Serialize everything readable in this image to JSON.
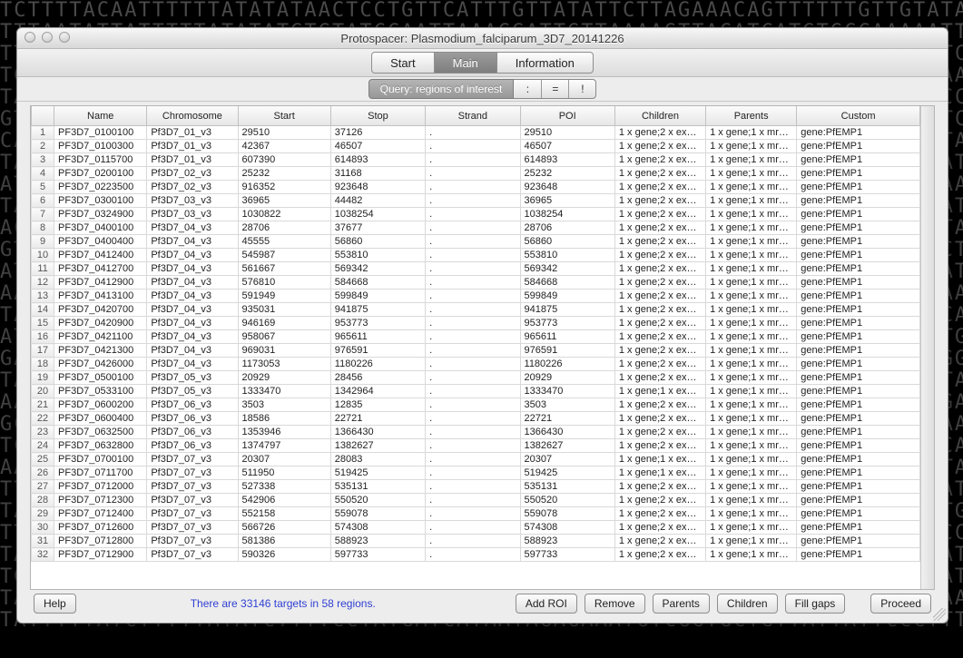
{
  "dna_backdrop": "TCTTTTACAATTTTTTATATATAACTCCTGTTCATTTGTTATATTCTTAGAAACAGTTTTTTGTTGTATAATTTATA\nTTTAATATTATTTTTATATATGTGTATCCAATTAAAGGATTGTTAAAAGTTACATCATGTGCCAAAAATTTTCTTAT\nTTACCATTTTTTATGTTGTTAAAATTTTTTGCGTTTTTTTACTTTTTGTCTGTATGGTTTTCTGTTGATCATTTTCT\nTGCATTTTTTTCCTCTCGGGTCGCCTCCAAAAAAGATTCTATAATAAAGAATGCTTGTTTCTCTTTGAAAATTGCGG\nTAGCAGTAAATACACATATTTTGTGGTAGAGTATACGAATAAAACAGAATAGGTCATAATATTCAGCACCGATAGAA\nGTCAAATCCTTCACGTCCTTTAAAATCGTTAGTTTTGACAATGTTGATGATGTTTTAATACTTCTTCTTCGCATTTT\nCATTTAAATTTGTTGTTTGTTTTATTGTTTGTTAAATCTTTTTTTAGTAAAAATTTTTTATAATAAAATATAATTCT\nTAAGAAACTCTTTTTTCCAAGACATTTCTCTTATTTAAAAAACATGAAATGTCATATAACGTTTTTAAATGCCCAGA\nATTTAATTTTATAATAAAATATAATTCTTAAGAAACTCTTTTTTCCAAGACATTTCTCTTATTTAAAAAACATGAAA\nTAAAGGATTGTTAAAAGTTACATCATGTGCCAAAAATTTTCTTATTTACCATTTTTTATGTTGTTAAAATTTTTTGC\nACAAAAATTTTCTTATTTACCATTTTTTATGTTGTTAAAATTTTTTGCGTTTTTTTACTTTTTGTCTGTATGGTTTT\nGTGCATATACCAAATTTAATTTTTCTCTATCATTTAATTTTATAATAAAATATAATTCTTAAGAAACTCTTTTTTCC\nATTATAAATAACAAGAATAAGATATCAGTACATAAAAATGTACATATTAAAAATTAAAAAAATTTATGATTCTATAT\nAATTAAAGGATTGTTAAAAGTTACATCATGTGCCAAAAATTTTCTTATTTACCATTTTTTATGTTGTTAAAATTTTT\nTAGCAATTACATGAAATTAAGTATAATAACATGGTAAAATATATAAAAAACAGCAATCCATTCATCAACAAAAAAAA\nATTCAGCACCGATAGAATGTCAAATCCTTCACGTCCTTTAAAATCGTTAGTTTTGACAATGTTGATGATGTTTTAAT\nGATGAAAGGCATTACCTTCCCAGCTCTTTCTTTTTTCAGCAATTACATGAAATTAAGTATAATAACATGGTAAAATA\nTATGCATCGAAATAATTTTATAATAAAATATAATTCTTAAGAAACTCTTTTTTCCAAGACATTTCTCTTATTTAAAA\nAAGTATAATAACATGGTAAAATATATAAAAAACAGCAATCCATTCATCAACAAAAAAAATTCAGCACCGATAGAATG\nGCGATAAATTTTGTTTATTTATTATTTTTCAAAGAGCGTCAATTAAATATTTTTTTTTTTTTTTTGGTAACCAAACC\nTCTATTTGTTTGTAATAGAGAATAACCAATACTTTGTGGCCCTAGCATCAACCCAAAATCAACCACATCAGGTACAG\nAATAAGAATGCATACAGCATATGCGTAATATTTTATTTTATTCCATTTTTATATTATTATTTCAATATTAATTAAAA\nTTTTGAATTTATTTTATATTTTAAAATAAATTACCATCCTATAAATAACAAGAATAAGATATCAGTACATAAAAATG\nTATTTTATAATAAAATATAATTCTTAAGAAACTCTTTTTTCCAAGACATTTCTCTTATTTAAAAAACATGAAATGTC\nTTCATTCATTATTACCGAGATAAAAAGTTTTATTATGCAAGCCATATCGATGTTTTTAATGATTCCACCCCCTGAAA\nTACCTCACCCATAATATATTCCAAATTTATGAAGGTCCAATCCATCAATGGTTTTTGCTACATAGGTAATTTTAGTT\nTGGGTCAATTTAATTAAATTCACCATTAGTAATAAAAAATTATCTCCAACATCATCTTTTCCTATGAGATATTGAGA\nTATTTATAATTTATTTGTTTTTTTTTTCTTTTTTTTCTTTTTTTAAGTTTGACCATAATCAAAATAAAAAATCACCT\nTATTTTTATCTTTTTATATCTTTTCCTATGATCATAATAGAGAAATGTCGGTGCTGTTATTATTCCCTTTGTTTCAA",
  "window": {
    "title": "Protospacer: Plasmodium_falciparum_3D7_20141226",
    "tabs": {
      "start": "Start",
      "main": "Main",
      "info": "Information"
    },
    "query_label": "Query: regions of interest",
    "query_ops": {
      "colon": ":",
      "eq": "=",
      "bang": "!"
    }
  },
  "columns": [
    "",
    "Name",
    "Chromosome",
    "Start",
    "Stop",
    "Strand",
    "POI",
    "Children",
    "Parents",
    "Custom"
  ],
  "status_line": "There are 33146 targets in 58 regions.",
  "buttons": {
    "help": "Help",
    "add_roi": "Add ROI",
    "remove": "Remove",
    "parents": "Parents",
    "children": "Children",
    "fill_gaps": "Fill gaps",
    "proceed": "Proceed"
  },
  "rows": [
    {
      "n": "1",
      "name": "PF3D7_0100100",
      "chr": "Pf3D7_01_v3",
      "start": "29510",
      "stop": "37126",
      "strand": ".",
      "poi": "29510",
      "children": "1 x gene;2 x ex…",
      "parents": "1 x gene;1 x mr…",
      "custom": "gene:PfEMP1"
    },
    {
      "n": "2",
      "name": "PF3D7_0100300",
      "chr": "Pf3D7_01_v3",
      "start": "42367",
      "stop": "46507",
      "strand": ".",
      "poi": "46507",
      "children": "1 x gene;2 x ex…",
      "parents": "1 x gene;1 x mr…",
      "custom": "gene:PfEMP1"
    },
    {
      "n": "3",
      "name": "PF3D7_0115700",
      "chr": "Pf3D7_01_v3",
      "start": "607390",
      "stop": "614893",
      "strand": ".",
      "poi": "614893",
      "children": "1 x gene;2 x ex…",
      "parents": "1 x gene;1 x mr…",
      "custom": "gene:PfEMP1"
    },
    {
      "n": "4",
      "name": "PF3D7_0200100",
      "chr": "Pf3D7_02_v3",
      "start": "25232",
      "stop": "31168",
      "strand": ".",
      "poi": "25232",
      "children": "1 x gene;2 x ex…",
      "parents": "1 x gene;1 x mr…",
      "custom": "gene:PfEMP1"
    },
    {
      "n": "5",
      "name": "PF3D7_0223500",
      "chr": "Pf3D7_02_v3",
      "start": "916352",
      "stop": "923648",
      "strand": ".",
      "poi": "923648",
      "children": "1 x gene;2 x ex…",
      "parents": "1 x gene;1 x mr…",
      "custom": "gene:PfEMP1"
    },
    {
      "n": "6",
      "name": "PF3D7_0300100",
      "chr": "Pf3D7_03_v3",
      "start": "36965",
      "stop": "44482",
      "strand": ".",
      "poi": "36965",
      "children": "1 x gene;2 x ex…",
      "parents": "1 x gene;1 x mr…",
      "custom": "gene:PfEMP1"
    },
    {
      "n": "7",
      "name": "PF3D7_0324900",
      "chr": "Pf3D7_03_v3",
      "start": "1030822",
      "stop": "1038254",
      "strand": ".",
      "poi": "1038254",
      "children": "1 x gene;2 x ex…",
      "parents": "1 x gene;1 x mr…",
      "custom": "gene:PfEMP1"
    },
    {
      "n": "8",
      "name": "PF3D7_0400100",
      "chr": "Pf3D7_04_v3",
      "start": "28706",
      "stop": "37677",
      "strand": ".",
      "poi": "28706",
      "children": "1 x gene;2 x ex…",
      "parents": "1 x gene;1 x mr…",
      "custom": "gene:PfEMP1"
    },
    {
      "n": "9",
      "name": "PF3D7_0400400",
      "chr": "Pf3D7_04_v3",
      "start": "45555",
      "stop": "56860",
      "strand": ".",
      "poi": "56860",
      "children": "1 x gene;2 x ex…",
      "parents": "1 x gene;1 x mr…",
      "custom": "gene:PfEMP1"
    },
    {
      "n": "10",
      "name": "PF3D7_0412400",
      "chr": "Pf3D7_04_v3",
      "start": "545987",
      "stop": "553810",
      "strand": ".",
      "poi": "553810",
      "children": "1 x gene;2 x ex…",
      "parents": "1 x gene;1 x mr…",
      "custom": "gene:PfEMP1"
    },
    {
      "n": "11",
      "name": "PF3D7_0412700",
      "chr": "Pf3D7_04_v3",
      "start": "561667",
      "stop": "569342",
      "strand": ".",
      "poi": "569342",
      "children": "1 x gene;2 x ex…",
      "parents": "1 x gene;1 x mr…",
      "custom": "gene:PfEMP1"
    },
    {
      "n": "12",
      "name": "PF3D7_0412900",
      "chr": "Pf3D7_04_v3",
      "start": "576810",
      "stop": "584668",
      "strand": ".",
      "poi": "584668",
      "children": "1 x gene;2 x ex…",
      "parents": "1 x gene;1 x mr…",
      "custom": "gene:PfEMP1"
    },
    {
      "n": "13",
      "name": "PF3D7_0413100",
      "chr": "Pf3D7_04_v3",
      "start": "591949",
      "stop": "599849",
      "strand": ".",
      "poi": "599849",
      "children": "1 x gene;2 x ex…",
      "parents": "1 x gene;1 x mr…",
      "custom": "gene:PfEMP1"
    },
    {
      "n": "14",
      "name": "PF3D7_0420700",
      "chr": "Pf3D7_04_v3",
      "start": "935031",
      "stop": "941875",
      "strand": ".",
      "poi": "941875",
      "children": "1 x gene;2 x ex…",
      "parents": "1 x gene;1 x mr…",
      "custom": "gene:PfEMP1"
    },
    {
      "n": "15",
      "name": "PF3D7_0420900",
      "chr": "Pf3D7_04_v3",
      "start": "946169",
      "stop": "953773",
      "strand": ".",
      "poi": "953773",
      "children": "1 x gene;2 x ex…",
      "parents": "1 x gene;1 x mr…",
      "custom": "gene:PfEMP1"
    },
    {
      "n": "16",
      "name": "PF3D7_0421100",
      "chr": "Pf3D7_04_v3",
      "start": "958067",
      "stop": "965611",
      "strand": ".",
      "poi": "965611",
      "children": "1 x gene;2 x ex…",
      "parents": "1 x gene;1 x mr…",
      "custom": "gene:PfEMP1"
    },
    {
      "n": "17",
      "name": "PF3D7_0421300",
      "chr": "Pf3D7_04_v3",
      "start": "969031",
      "stop": "976591",
      "strand": ".",
      "poi": "976591",
      "children": "1 x gene;2 x ex…",
      "parents": "1 x gene;1 x mr…",
      "custom": "gene:PfEMP1"
    },
    {
      "n": "18",
      "name": "PF3D7_0426000",
      "chr": "Pf3D7_04_v3",
      "start": "1173053",
      "stop": "1180226",
      "strand": ".",
      "poi": "1180226",
      "children": "1 x gene;2 x ex…",
      "parents": "1 x gene;1 x mr…",
      "custom": "gene:PfEMP1"
    },
    {
      "n": "19",
      "name": "PF3D7_0500100",
      "chr": "Pf3D7_05_v3",
      "start": "20929",
      "stop": "28456",
      "strand": ".",
      "poi": "20929",
      "children": "1 x gene;2 x ex…",
      "parents": "1 x gene;1 x mr…",
      "custom": "gene:PfEMP1"
    },
    {
      "n": "20",
      "name": "PF3D7_0533100",
      "chr": "Pf3D7_05_v3",
      "start": "1333470",
      "stop": "1342964",
      "strand": ".",
      "poi": "1333470",
      "children": "1 x gene;1 x ex…",
      "parents": "1 x gene;1 x mr…",
      "custom": "gene:PfEMP1"
    },
    {
      "n": "21",
      "name": "PF3D7_0600200",
      "chr": "Pf3D7_06_v3",
      "start": "3503",
      "stop": "12835",
      "strand": ".",
      "poi": "3503",
      "children": "1 x gene;2 x ex…",
      "parents": "1 x gene;1 x mr…",
      "custom": "gene:PfEMP1"
    },
    {
      "n": "22",
      "name": "PF3D7_0600400",
      "chr": "Pf3D7_06_v3",
      "start": "18586",
      "stop": "22721",
      "strand": ".",
      "poi": "22721",
      "children": "1 x gene;2 x ex…",
      "parents": "1 x gene;1 x mr…",
      "custom": "gene:PfEMP1"
    },
    {
      "n": "23",
      "name": "PF3D7_0632500",
      "chr": "Pf3D7_06_v3",
      "start": "1353946",
      "stop": "1366430",
      "strand": ".",
      "poi": "1366430",
      "children": "1 x gene;2 x ex…",
      "parents": "1 x gene;1 x mr…",
      "custom": "gene:PfEMP1"
    },
    {
      "n": "24",
      "name": "PF3D7_0632800",
      "chr": "Pf3D7_06_v3",
      "start": "1374797",
      "stop": "1382627",
      "strand": ".",
      "poi": "1382627",
      "children": "1 x gene;2 x ex…",
      "parents": "1 x gene;1 x mr…",
      "custom": "gene:PfEMP1"
    },
    {
      "n": "25",
      "name": "PF3D7_0700100",
      "chr": "Pf3D7_07_v3",
      "start": "20307",
      "stop": "28083",
      "strand": ".",
      "poi": "20307",
      "children": "1 x gene;1 x ex…",
      "parents": "1 x gene;1 x mr…",
      "custom": "gene:PfEMP1"
    },
    {
      "n": "26",
      "name": "PF3D7_0711700",
      "chr": "Pf3D7_07_v3",
      "start": "511950",
      "stop": "519425",
      "strand": ".",
      "poi": "519425",
      "children": "1 x gene;1 x ex…",
      "parents": "1 x gene;1 x mr…",
      "custom": "gene:PfEMP1"
    },
    {
      "n": "27",
      "name": "PF3D7_0712000",
      "chr": "Pf3D7_07_v3",
      "start": "527338",
      "stop": "535131",
      "strand": ".",
      "poi": "535131",
      "children": "1 x gene;2 x ex…",
      "parents": "1 x gene;1 x mr…",
      "custom": "gene:PfEMP1"
    },
    {
      "n": "28",
      "name": "PF3D7_0712300",
      "chr": "Pf3D7_07_v3",
      "start": "542906",
      "stop": "550520",
      "strand": ".",
      "poi": "550520",
      "children": "1 x gene;2 x ex…",
      "parents": "1 x gene;1 x mr…",
      "custom": "gene:PfEMP1"
    },
    {
      "n": "29",
      "name": "PF3D7_0712400",
      "chr": "Pf3D7_07_v3",
      "start": "552158",
      "stop": "559078",
      "strand": ".",
      "poi": "559078",
      "children": "1 x gene;2 x ex…",
      "parents": "1 x gene;1 x mr…",
      "custom": "gene:PfEMP1"
    },
    {
      "n": "30",
      "name": "PF3D7_0712600",
      "chr": "Pf3D7_07_v3",
      "start": "566726",
      "stop": "574308",
      "strand": ".",
      "poi": "574308",
      "children": "1 x gene;2 x ex…",
      "parents": "1 x gene;1 x mr…",
      "custom": "gene:PfEMP1"
    },
    {
      "n": "31",
      "name": "PF3D7_0712800",
      "chr": "Pf3D7_07_v3",
      "start": "581386",
      "stop": "588923",
      "strand": ".",
      "poi": "588923",
      "children": "1 x gene;2 x ex…",
      "parents": "1 x gene;1 x mr…",
      "custom": "gene:PfEMP1"
    },
    {
      "n": "32",
      "name": "PF3D7_0712900",
      "chr": "Pf3D7_07_v3",
      "start": "590326",
      "stop": "597733",
      "strand": ".",
      "poi": "597733",
      "children": "1 x gene;2 x ex…",
      "parents": "1 x gene;1 x mr…",
      "custom": "gene:PfEMP1"
    }
  ]
}
